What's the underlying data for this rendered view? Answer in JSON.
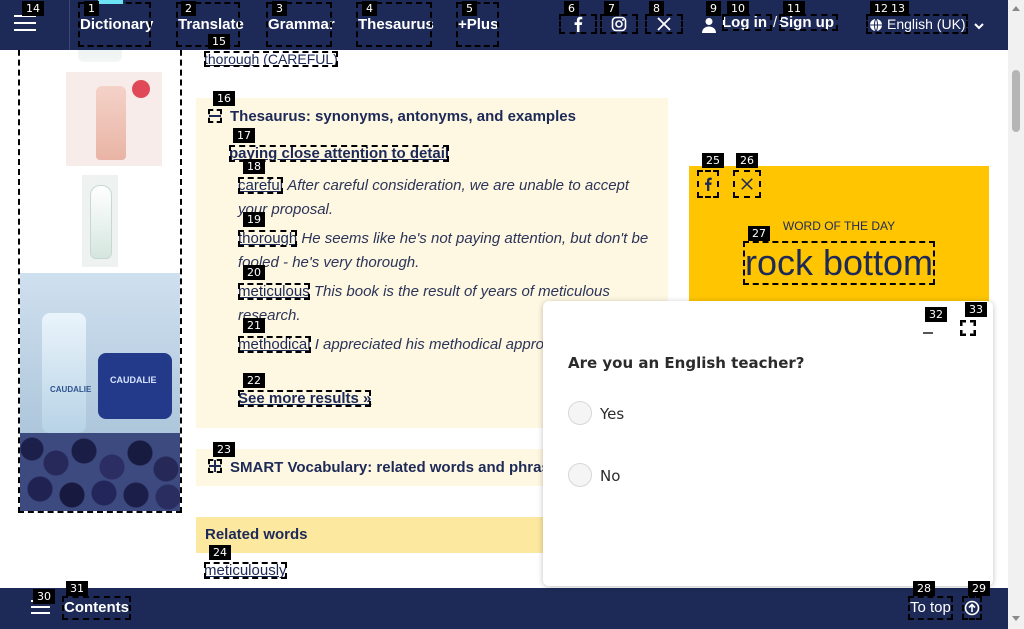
{
  "nav": {
    "items": [
      {
        "label": "Dictionary"
      },
      {
        "label": "Translate"
      },
      {
        "label": "Grammar"
      },
      {
        "label": "Thesaurus"
      },
      {
        "label": "+Plus"
      }
    ],
    "login": "Log in",
    "slash": "/",
    "signup": "Sign up",
    "language": "English (UK)",
    "icons": [
      "menu-icon",
      "facebook-icon",
      "instagram-icon",
      "x-icon",
      "user-icon",
      "globe-icon",
      "chevron-down-icon"
    ]
  },
  "headword": {
    "word": "thorough",
    "tag": "(CAREFUL)"
  },
  "thesaurus": {
    "title": "Thesaurus: synonyms, antonyms, and examples",
    "sense": "paying close attention to detail",
    "synonyms": [
      {
        "word": "careful",
        "example": "After careful consideration, we are unable to accept your proposal."
      },
      {
        "word": "thorough",
        "example": "He seems like he's not paying attention, but don't be fooled - he's very thorough."
      },
      {
        "word": "meticulous",
        "example": "This book is the result of years of meticulous research."
      },
      {
        "word": "methodical",
        "example": "I appreciated his methodical approach to the work."
      }
    ],
    "see_more": "See more results »"
  },
  "smart": {
    "title": "SMART Vocabulary: related words and phrases"
  },
  "related": {
    "title": "Related words",
    "words": [
      "meticulously"
    ]
  },
  "wotd": {
    "label": "WORD OF THE DAY",
    "word": "rock bottom",
    "bg": "#fec500"
  },
  "survey": {
    "question": "Are you an English teacher?",
    "options": [
      "Yes",
      "No"
    ]
  },
  "bottom": {
    "contents": "Contents",
    "to_top": "To top"
  },
  "badges": [
    "1",
    "2",
    "3",
    "4",
    "5",
    "6",
    "7",
    "8",
    "9",
    "10",
    "11",
    "12",
    "13",
    "14",
    "15",
    "16",
    "17",
    "18",
    "19",
    "20",
    "21",
    "22",
    "23",
    "24",
    "25",
    "26",
    "27",
    "28",
    "29",
    "30",
    "31",
    "32",
    "33"
  ],
  "colors": {
    "navy": "#1d2a57",
    "cream": "#fef7e1",
    "related_bg": "#fde8a0",
    "accent": "#6ee2f5"
  }
}
